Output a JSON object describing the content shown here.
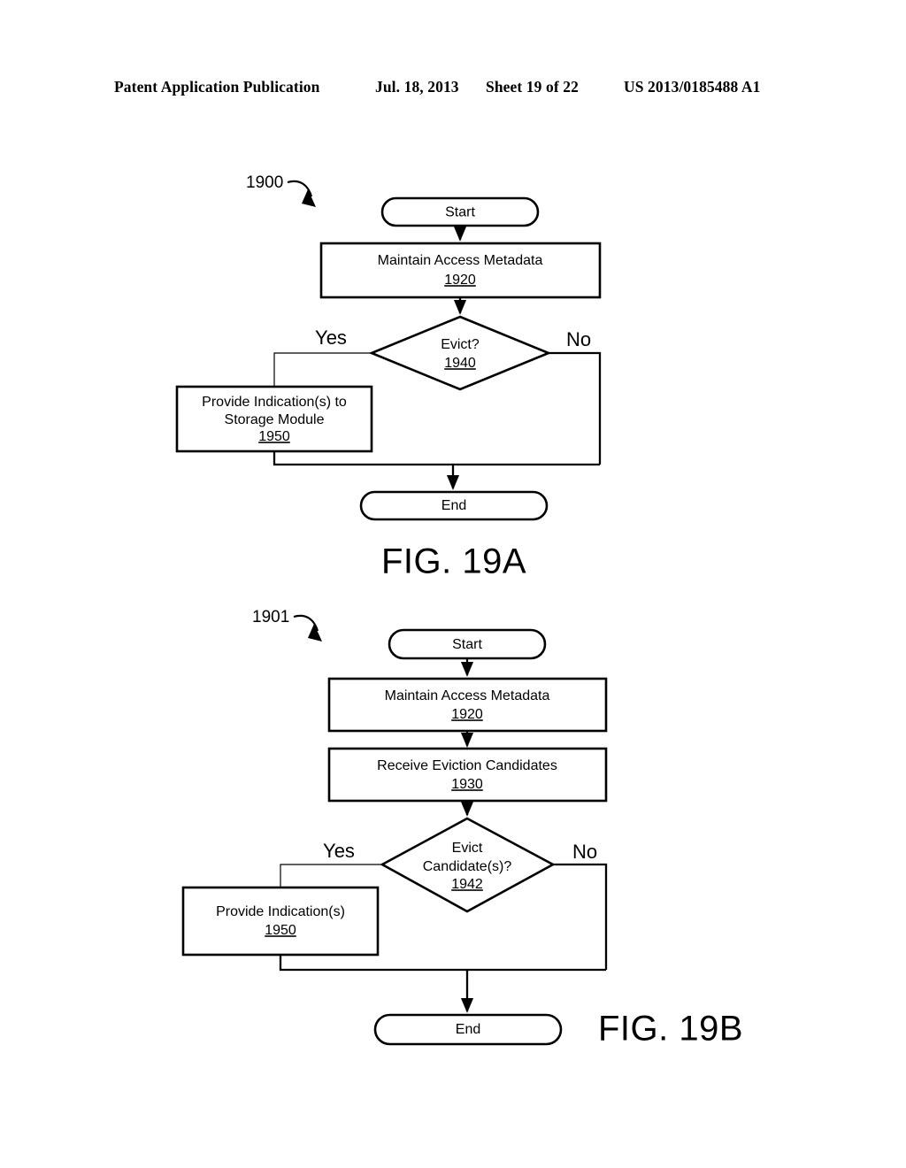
{
  "header": {
    "title": "Patent Application Publication",
    "date": "Jul. 18, 2013",
    "sheet": "Sheet 19 of 22",
    "patent_number": "US 2013/0185488 A1"
  },
  "figures": [
    {
      "id": "fig-19a",
      "caption": "FIG. 19A",
      "flow_ref": "1900",
      "nodes": {
        "start": {
          "label": "Start",
          "shape": "terminator"
        },
        "maintain": {
          "label": "Maintain Access Metadata",
          "ref": "1920",
          "shape": "process"
        },
        "decision": {
          "label": "Evict?",
          "ref": "1940",
          "shape": "decision"
        },
        "provide": {
          "label_line1": "Provide Indication(s) to",
          "label_line2": "Storage Module",
          "ref": "1950",
          "shape": "process"
        },
        "end": {
          "label": "End",
          "shape": "terminator"
        }
      },
      "branches": {
        "yes": "Yes",
        "no": "No"
      }
    },
    {
      "id": "fig-19b",
      "caption": "FIG. 19B",
      "flow_ref": "1901",
      "nodes": {
        "start": {
          "label": "Start",
          "shape": "terminator"
        },
        "maintain": {
          "label": "Maintain Access Metadata",
          "ref": "1920",
          "shape": "process"
        },
        "receive": {
          "label": "Receive Eviction Candidates",
          "ref": "1930",
          "shape": "process"
        },
        "decision": {
          "label_line1": "Evict",
          "label_line2": "Candidate(s)?",
          "ref": "1942",
          "shape": "decision"
        },
        "provide": {
          "label": "Provide Indication(s)",
          "ref": "1950",
          "shape": "process"
        },
        "end": {
          "label": "End",
          "shape": "terminator"
        }
      },
      "branches": {
        "yes": "Yes",
        "no": "No"
      }
    }
  ],
  "colors": {
    "ink": "#000000",
    "paper": "#ffffff"
  }
}
